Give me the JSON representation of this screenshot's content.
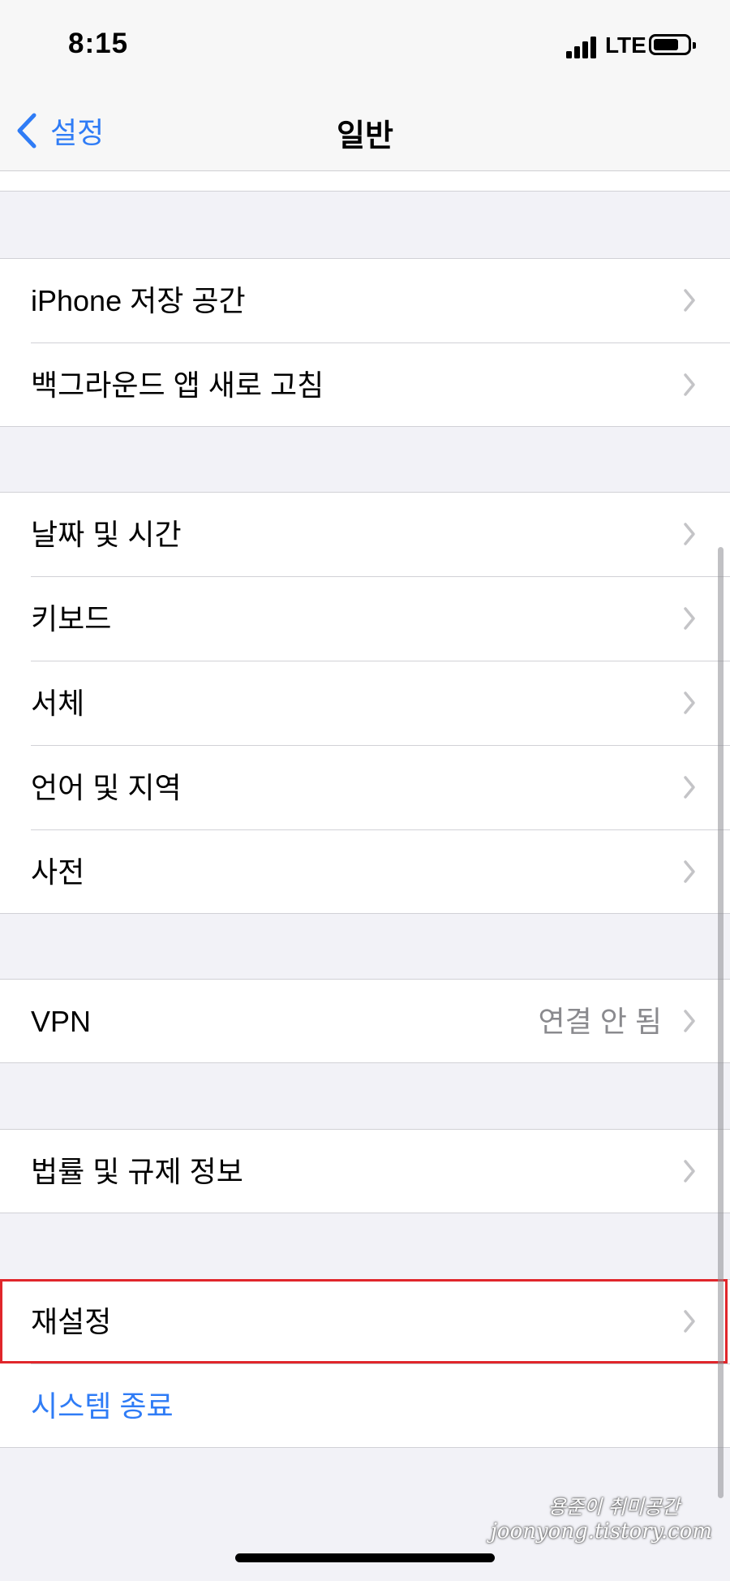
{
  "status": {
    "time": "8:15",
    "carrier": "LTE"
  },
  "nav": {
    "back_label": "설정",
    "title": "일반"
  },
  "groups": {
    "storage": [
      {
        "label": "iPhone 저장 공간"
      },
      {
        "label": "백그라운드 앱 새로 고침"
      }
    ],
    "locale": [
      {
        "label": "날짜 및 시간"
      },
      {
        "label": "키보드"
      },
      {
        "label": "서체"
      },
      {
        "label": "언어 및 지역"
      },
      {
        "label": "사전"
      }
    ],
    "vpn": {
      "label": "VPN",
      "value": "연결 안 됨"
    },
    "legal": {
      "label": "법률 및 규제 정보"
    },
    "reset": {
      "label": "재설정"
    },
    "shutdown": {
      "label": "시스템 종료"
    }
  },
  "watermark": {
    "line1": "용준이 취미공간",
    "line2": "joonyong.tistory.com"
  },
  "colors": {
    "accent": "#2f7cf6",
    "highlight": "#e0262b",
    "background": "#f2f2f7"
  }
}
